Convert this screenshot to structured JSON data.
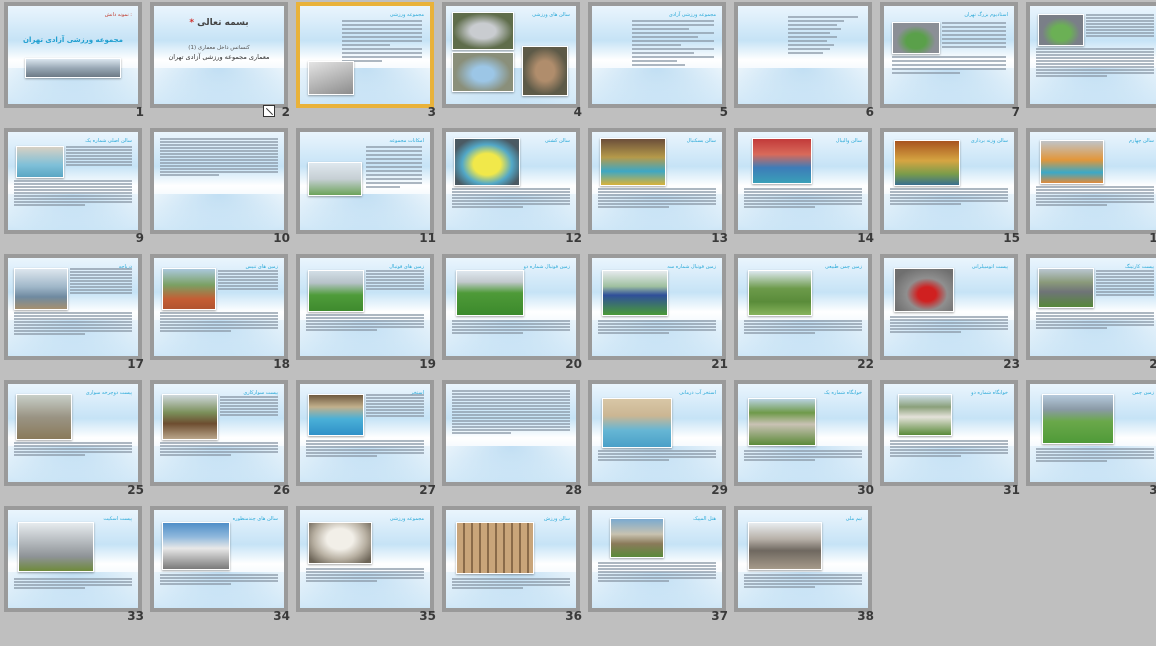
{
  "slides": [
    {
      "number": "1",
      "title": "مجموعه ورزشی آزادی تهران",
      "corner": "نمونه دانش :"
    },
    {
      "number": "2",
      "title": "بسمه تعالی",
      "subtitle": "کنسانس داخل معماری (1)",
      "heading": "معماری مجموعه ورزشی آزادی تهران"
    },
    {
      "number": "3",
      "title": "مجموعه ورزشی"
    },
    {
      "number": "4",
      "title": "سالن های ورزشی"
    },
    {
      "number": "5",
      "title": "مجموعه ورزشی آزادی"
    },
    {
      "number": "6",
      "title": ""
    },
    {
      "number": "7",
      "title": "استادیوم بزرگ تهران"
    },
    {
      "number": "8",
      "title": ""
    },
    {
      "number": "9",
      "title": "سالن اصلی شماره یک"
    },
    {
      "number": "10",
      "title": ""
    },
    {
      "number": "11",
      "title": "امکانات مجموعه"
    },
    {
      "number": "12",
      "title": "سالن کشتی"
    },
    {
      "number": "13",
      "title": "سالن بسکتبال"
    },
    {
      "number": "14",
      "title": "سالن والیبال"
    },
    {
      "number": "15",
      "title": "سالن وزنه برداری"
    },
    {
      "number": "16",
      "title": "سالن چهارم"
    },
    {
      "number": "17",
      "title": "دریاچه"
    },
    {
      "number": "18",
      "title": "زمین های تنیس"
    },
    {
      "number": "19",
      "title": "زمین های فوتبال"
    },
    {
      "number": "20",
      "title": "زمین فوتبال شماره دو"
    },
    {
      "number": "21",
      "title": "زمین فوتبال شماره سه"
    },
    {
      "number": "22",
      "title": "زمین چمن طبیعی"
    },
    {
      "number": "23",
      "title": "پیست اتومبیلرانی"
    },
    {
      "number": "24",
      "title": "پیست کارتینگ"
    },
    {
      "number": "25",
      "title": "پیست دوچرخه سواری"
    },
    {
      "number": "26",
      "title": "پیست سوارکاری"
    },
    {
      "number": "27",
      "title": "استخر"
    },
    {
      "number": "28",
      "title": ""
    },
    {
      "number": "29",
      "title": "استخر آب درمانی"
    },
    {
      "number": "30",
      "title": "خوابگاه شماره یک"
    },
    {
      "number": "31",
      "title": "خوابگاه شماره دو"
    },
    {
      "number": "32",
      "title": "زمین چمن"
    },
    {
      "number": "33",
      "title": "پیست اسکیت"
    },
    {
      "number": "34",
      "title": "سالن های چندمنظوره"
    },
    {
      "number": "35",
      "title": "مجموعه ورزشی"
    },
    {
      "number": "36",
      "title": "سالن ورزش"
    },
    {
      "number": "37",
      "title": "هتل المپیک"
    },
    {
      "number": "38",
      "title": "تیم ملی"
    }
  ],
  "icons": {
    "notes": "hidden-slide-icon"
  },
  "colors": {
    "selected_border": "#e9b23a",
    "slide_border": "#9a9a9a",
    "background": "#bfbfbf",
    "title_color": "#2aa9d8"
  }
}
